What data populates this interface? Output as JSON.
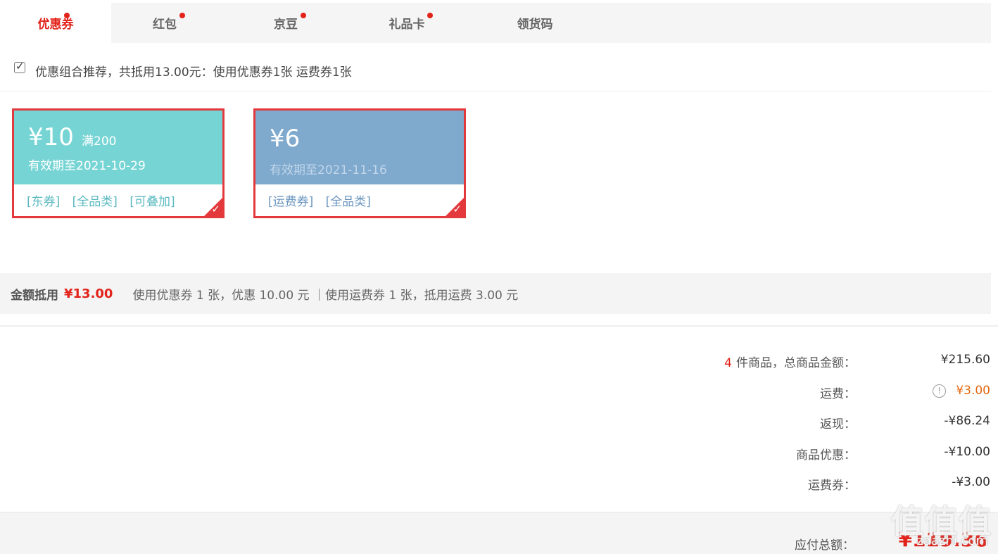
{
  "tabs": [
    {
      "label": "优惠券",
      "active": true,
      "dot": true
    },
    {
      "label": "红包",
      "active": false,
      "dot": true
    },
    {
      "label": "京豆",
      "active": false,
      "dot": true
    },
    {
      "label": "礼品卡",
      "active": false,
      "dot": true
    },
    {
      "label": "领货码",
      "active": false,
      "dot": false
    }
  ],
  "recommend": {
    "checked": true,
    "text": "优惠组合推荐，共抵用13.00元：使用优惠券1张 运费券1张"
  },
  "coupons": [
    {
      "amount": "¥10",
      "condition": "满200",
      "expiry": "有效期至2021-10-29",
      "tags": [
        "[东券]",
        "[全品类]",
        "[可叠加]"
      ],
      "selected": true,
      "color": "#76d4d4"
    },
    {
      "amount": "¥6",
      "condition": "",
      "expiry": "有效期至2021-11-16",
      "tags": [
        "[运费券]",
        "[全品类]"
      ],
      "selected": true,
      "color": "#7fa9cd"
    }
  ],
  "summary": {
    "label": "金额抵用",
    "amount": "¥13.00",
    "detail": "使用优惠券 1 张，优惠 10.00 元 ｜使用运费券 1 张，抵用运费 3.00 元"
  },
  "totals": {
    "items": {
      "count": "4",
      "label": "件商品，总商品金额：",
      "value": "¥215.60"
    },
    "shipping": {
      "label": "运费：",
      "value": "¥3.00",
      "icon": "info-icon"
    },
    "cashback": {
      "label": "返现：",
      "value": "-¥86.24"
    },
    "discount": {
      "label": "商品优惠：",
      "value": "-¥10.00"
    },
    "shipping_coupon": {
      "label": "运费券：",
      "value": "-¥3.00"
    },
    "payable": {
      "label": "应付总额：",
      "value": "¥119.36"
    }
  },
  "watermark": {
    "text": "值值值",
    "sub": "zaazhi.com"
  }
}
